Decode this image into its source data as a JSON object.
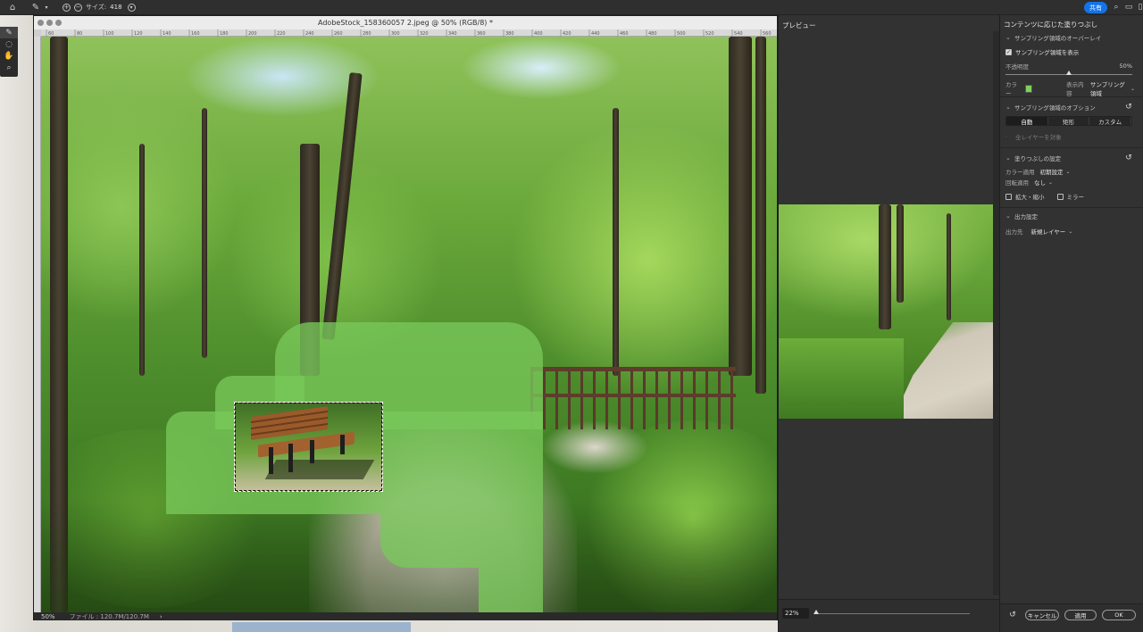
{
  "topbar": {
    "size_label": "サイズ:",
    "size_value": "418",
    "share_label": "共有",
    "home_icon": "home-icon",
    "brush_icon": "brush-icon"
  },
  "toolbar": {
    "tools": [
      "brush-icon",
      "lasso-icon",
      "hand-icon",
      "zoom-icon"
    ]
  },
  "document": {
    "title": "AdobeStock_158360057 2.jpeg @ 50% (RGB/8) *",
    "ruler_top": [
      "60",
      "80",
      "100",
      "120",
      "140",
      "160",
      "180",
      "200",
      "220",
      "240",
      "260",
      "280",
      "300",
      "320",
      "340",
      "360",
      "380",
      "400",
      "420",
      "440",
      "460",
      "480",
      "500",
      "520",
      "540",
      "560"
    ],
    "zoom": "50%",
    "file_info": "ファイル : 120.7M/120.7M",
    "status_chevron": "›"
  },
  "preview": {
    "tab_label": "プレビュー",
    "zoom_value": "22%",
    "zoom_level": 0.0
  },
  "panel": {
    "title": "コンテンツに応じた塗りつぶし",
    "overlay": {
      "heading": "サンプリング領域のオーバーレイ",
      "show_label": "サンプリング領域を表示",
      "show_checked": true,
      "opacity_label": "不透明度",
      "opacity_value": "50%",
      "opacity_level": 0.5,
      "color_label": "カラー",
      "color": "#7fd15b",
      "display_label": "表示内容",
      "display_value": "サンプリング領域"
    },
    "sampling_options": {
      "heading": "サンプリング領域のオプション",
      "modes": [
        "自動",
        "矩形",
        "カスタム"
      ],
      "active_mode": "自動",
      "all_layers_label": "全レイヤーを対象"
    },
    "fill_settings": {
      "heading": "塗りつぶしの設定",
      "color_adapt_label": "カラー適用",
      "color_adapt_value": "初期設定",
      "rotation_label": "回転適用",
      "rotation_value": "なし",
      "scale_label": "拡大・縮小",
      "mirror_label": "ミラー"
    },
    "output": {
      "heading": "出力設定",
      "output_to_label": "出力先",
      "output_to_value": "新規レイヤー"
    },
    "buttons": {
      "cancel": "キャンセル",
      "apply": "適用",
      "ok": "OK"
    }
  },
  "colors": {
    "accent": "#1473e6",
    "overlay_green": "#7fd15b",
    "panel_bg": "#323232"
  }
}
